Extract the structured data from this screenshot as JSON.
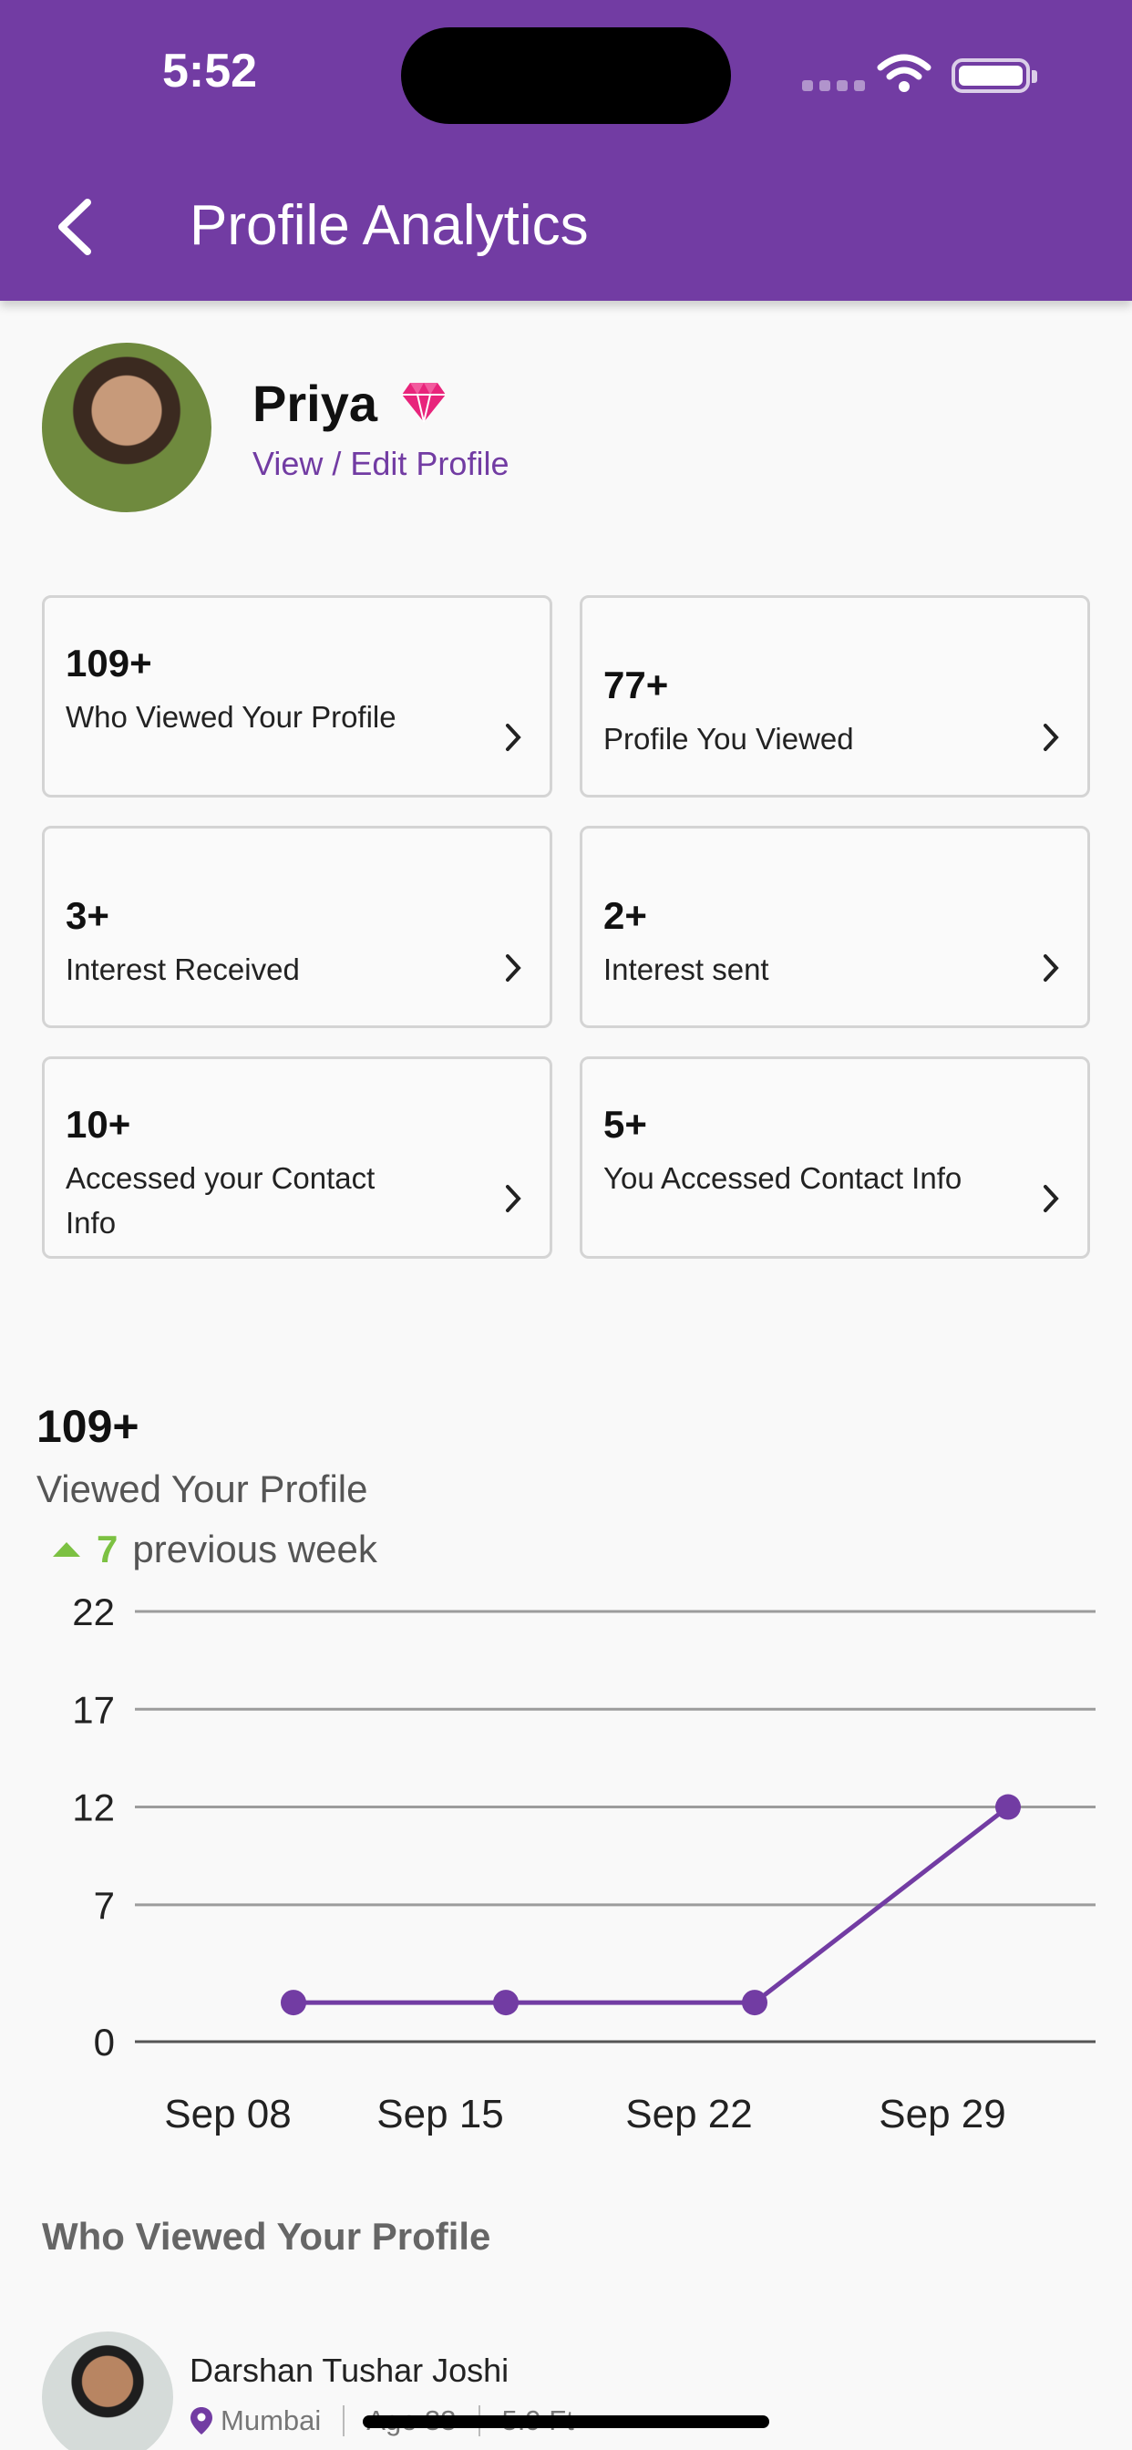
{
  "status_bar": {
    "time": "5:52"
  },
  "header": {
    "title": "Profile Analytics"
  },
  "profile": {
    "name": "Priya",
    "edit_link": "View / Edit Profile"
  },
  "stats": [
    {
      "value": "109+",
      "label": "Who Viewed Your Profile"
    },
    {
      "value": "77+",
      "label": "Profile You Viewed"
    },
    {
      "value": "3+",
      "label": "Interest Received"
    },
    {
      "value": "2+",
      "label": "Interest sent"
    },
    {
      "value": "10+",
      "label": "Accessed your Contact Info"
    },
    {
      "value": "5+",
      "label": "You Accessed Contact Info"
    }
  ],
  "analytics": {
    "total": "109+",
    "subtitle": "Viewed Your Profile",
    "trend_value": "7",
    "trend_text": "previous week"
  },
  "colors": {
    "primary": "#723ca3",
    "positive": "#7cc142"
  },
  "chart_data": {
    "type": "line",
    "categories": [
      "Sep 08",
      "Sep 15",
      "Sep 22",
      "Sep 29"
    ],
    "values": [
      2,
      2,
      2,
      12
    ],
    "title": "",
    "xlabel": "",
    "ylabel": "",
    "yticks": [
      0,
      7,
      12,
      17,
      22
    ],
    "ylim": [
      0,
      22
    ],
    "grid": true
  },
  "viewers_section": {
    "title": "Who Viewed Your Profile"
  },
  "viewers": [
    {
      "name": "Darshan Tushar Joshi",
      "city": "Mumbai",
      "age": "Age 33",
      "height": "5.9 Ft"
    }
  ]
}
